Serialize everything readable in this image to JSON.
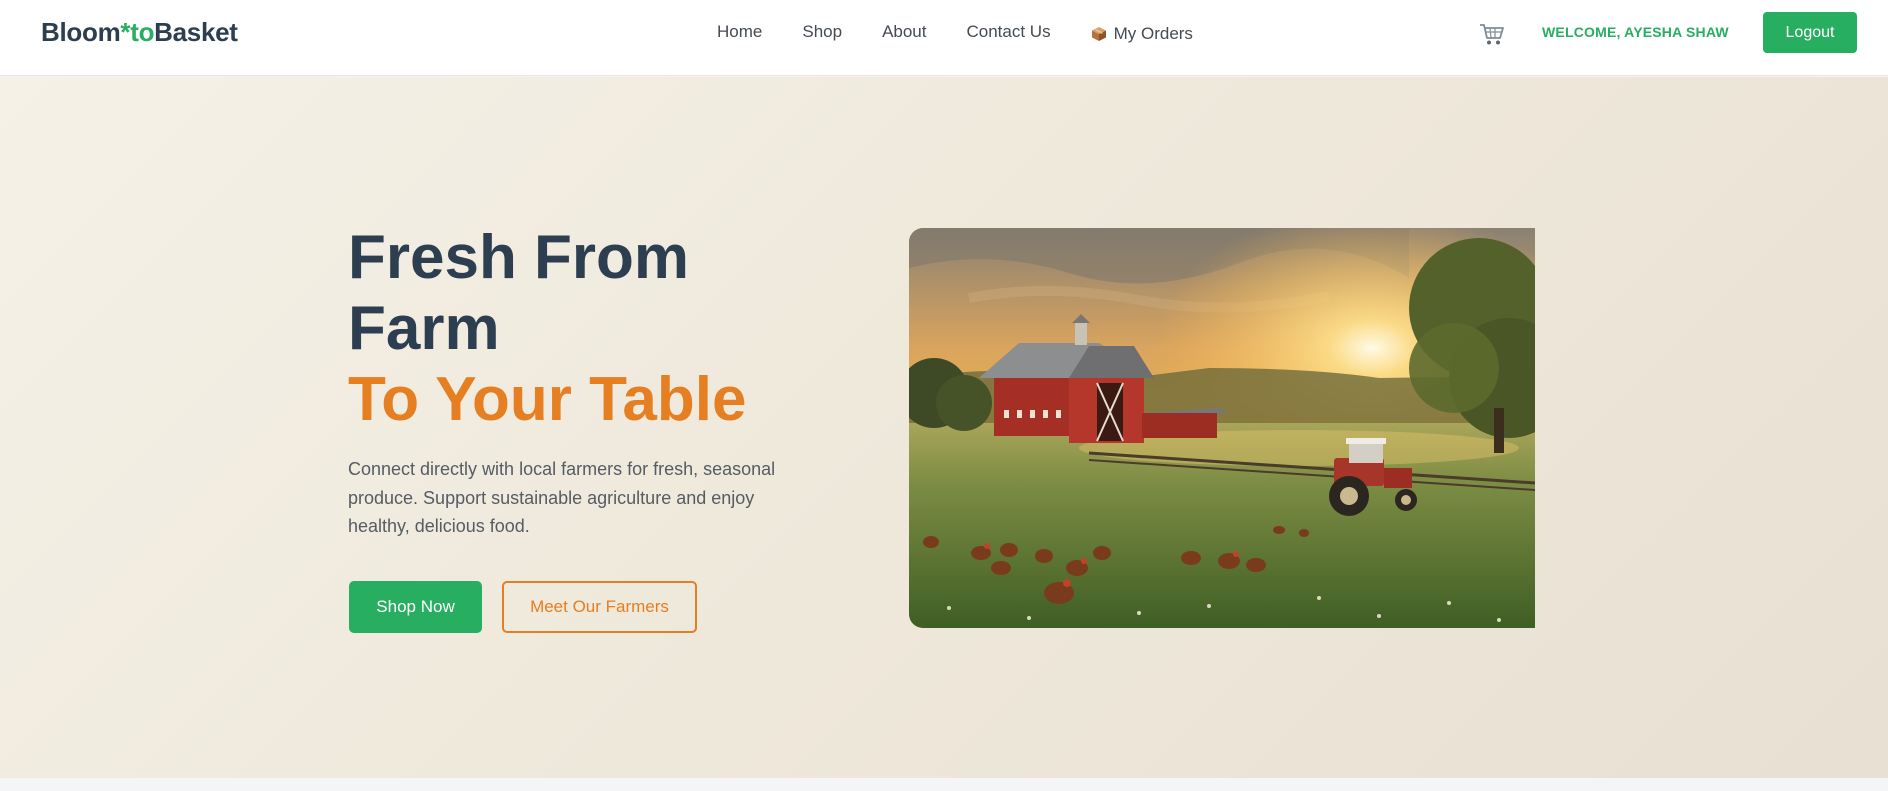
{
  "brand": {
    "part1": "Bloom",
    "part2": "*to",
    "part3": "Basket",
    "accent_color": "#27ae60",
    "text_color": "#2c3e50"
  },
  "nav": {
    "links": [
      "Home",
      "Shop",
      "About",
      "Contact Us"
    ],
    "orders_label": "My Orders",
    "orders_icon": "package-icon"
  },
  "header": {
    "cart_icon": "shopping-cart-icon",
    "welcome_text": "WELCOME, AYESHA SHAW",
    "logout_label": "Logout"
  },
  "hero": {
    "title_line1": "Fresh From",
    "title_line2": "Farm",
    "title_highlight": "To Your Table",
    "description": "Connect directly with local farmers for fresh, seasonal produce. Support sustainable agriculture and enjoy healthy, delicious food.",
    "primary_button": "Shop Now",
    "secondary_button": "Meet Our Farmers",
    "highlight_color": "#e67e22",
    "image_subject": "farm-sunset-barn-tractor-chickens"
  }
}
